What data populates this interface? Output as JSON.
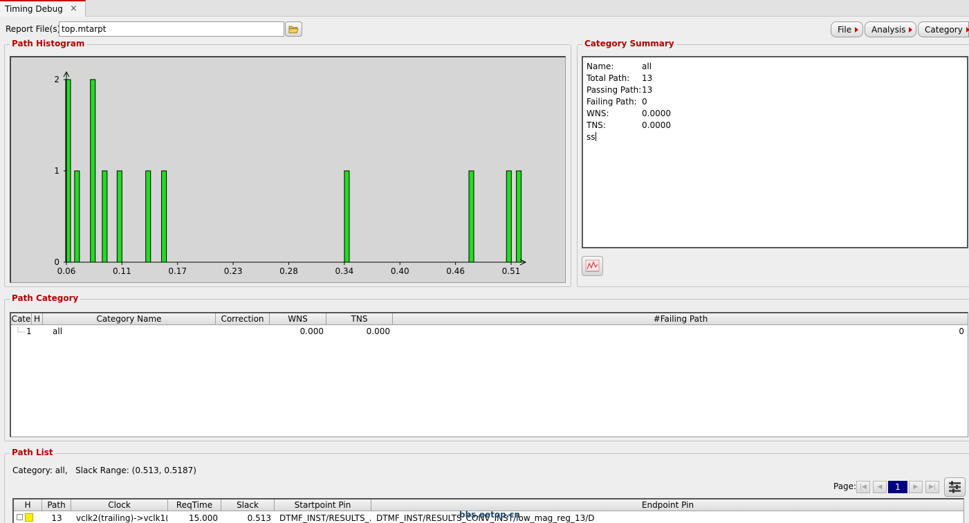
{
  "tab": {
    "title": "Timing Debug",
    "close": "×"
  },
  "report": {
    "label": "Report File(s)",
    "value": "top.mtarpt"
  },
  "menus": {
    "file": "File",
    "analysis": "Analysis",
    "category": "Category"
  },
  "icons": {
    "folder": "folder-open-icon",
    "chart": "chart-icon",
    "settings": "table-settings-icon",
    "first": "first-page-icon",
    "prev": "prev-page-icon",
    "next": "next-page-icon",
    "last": "last-page-icon"
  },
  "colors": {
    "accent": "#b30000",
    "bar": "#22dd22",
    "page_selected": "#000080"
  },
  "histogram": {
    "title": "Path Histogram"
  },
  "chart_data": {
    "type": "bar",
    "x": [
      0.06,
      0.069,
      0.085,
      0.097,
      0.112,
      0.141,
      0.157,
      0.342,
      0.468,
      0.506,
      0.516
    ],
    "values": [
      2,
      1,
      2,
      1,
      1,
      1,
      1,
      1,
      1,
      1,
      1
    ],
    "x_ticks": [
      "0.06",
      "0.11",
      "0.17",
      "0.23",
      "0.28",
      "0.34",
      "0.40",
      "0.46",
      "0.51"
    ],
    "y_ticks": [
      "0",
      "1",
      "2"
    ],
    "xlim": [
      0.06,
      0.51
    ],
    "ylim": [
      0,
      2
    ],
    "grid": false
  },
  "summary": {
    "title": "Category Summary",
    "rows": [
      {
        "key": "Name:",
        "value": "all"
      },
      {
        "key": "Total Path:",
        "value": "13"
      },
      {
        "key": "Passing Path:",
        "value": "13"
      },
      {
        "key": "Failing Path:",
        "value": "0"
      },
      {
        "key": "WNS:",
        "value": "0.0000"
      },
      {
        "key": "TNS:",
        "value": "0.0000"
      }
    ],
    "note": "ss"
  },
  "path_category": {
    "title": "Path Category",
    "columns": [
      "Cate",
      "H",
      "Category Name",
      "Correction",
      "WNS",
      "TNS",
      "#Failing Path"
    ],
    "rows": [
      {
        "id": "1",
        "h": "",
        "name": "all",
        "correction": "",
        "wns": "0.000",
        "tns": "0.000",
        "failing": "0"
      }
    ]
  },
  "path_list": {
    "title": "Path List",
    "category_label": "Category: all,",
    "slack_range": "Slack Range: (0.513, 0.5187)",
    "page_label": "Page:",
    "page": "1",
    "columns": [
      "H",
      "Path",
      "Clock",
      "ReqTime",
      "Slack",
      "Startpoint Pin",
      "Endpoint Pin"
    ],
    "rows": [
      {
        "h": "",
        "path": "13",
        "clock": "vclk2(trailing)->vclk1(l...",
        "reqtime": "15.000",
        "slack": "0.513",
        "startpoint": "DTMF_INST/RESULTS_...",
        "endpoint": "DTMF_INST/RESULTS_CONV_INST/low_mag_reg_13/D"
      }
    ]
  },
  "watermark": "bbs.eetop.cn"
}
